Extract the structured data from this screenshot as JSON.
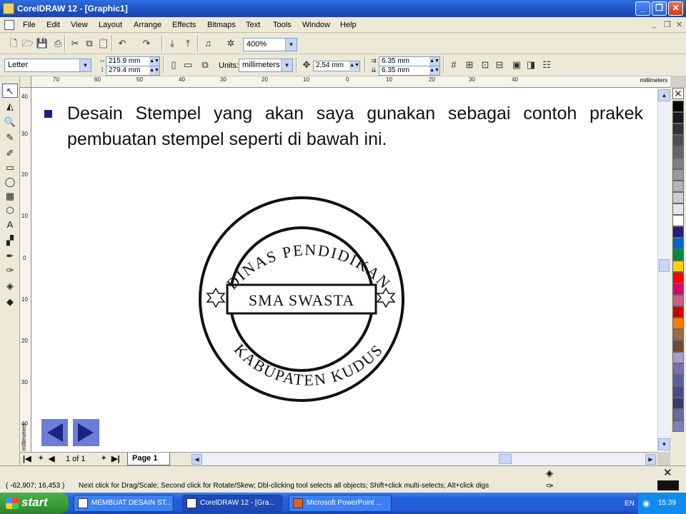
{
  "window": {
    "title": "CorelDRAW 12 - [Graphic1]"
  },
  "menu": [
    "File",
    "Edit",
    "View",
    "Layout",
    "Arrange",
    "Effects",
    "Bitmaps",
    "Text",
    "Tools",
    "Window",
    "Help"
  ],
  "toolbar": {
    "zoom": "400%"
  },
  "property_bar": {
    "paper": "Letter",
    "width": "215.9 mm",
    "height": "279.4 mm",
    "units_label": "Units:",
    "units": "millimeters",
    "nudge": "2,54 mm",
    "dup_x": "6.35 mm",
    "dup_y": "6.35 mm"
  },
  "ruler": {
    "unit": "millimeters",
    "h_labels": [
      "70",
      "60",
      "50",
      "40",
      "30",
      "20",
      "10",
      "0",
      "10",
      "20",
      "30",
      "40"
    ],
    "v_labels": [
      "40",
      "30",
      "20",
      "10",
      "0",
      "10",
      "20",
      "30",
      "40"
    ]
  },
  "slide": {
    "text": "Desain Stempel yang akan saya gunakan sebagai contoh prakek pembuatan stempel seperti di bawah ini.",
    "stamp_top": "DINAS PENDIDIKAN",
    "stamp_middle": "SMA SWASTA",
    "stamp_bottom": "KABUPATEN KUDUS",
    "accent_color": "#1a237e",
    "nav_color": "#6b7dd6"
  },
  "pagebar": {
    "count": "1 of 1",
    "tab": "Page 1"
  },
  "status": {
    "coords": "( -62,907; 16,453 )",
    "message": "Next click for Drag/Scale; Second click for Rotate/Skew; Dbl-clicking tool selects all objects; Shift+click multi-selects; Alt+click digs"
  },
  "palette": [
    "#000000",
    "#1a1a1a",
    "#333333",
    "#4d4d4d",
    "#666666",
    "#808080",
    "#999999",
    "#b3b3b3",
    "#cccccc",
    "#e6e6e6",
    "#ffffff",
    "#2b1a7a",
    "#0066cc",
    "#008a3e",
    "#ffd200",
    "#ff0000",
    "#e0006a",
    "#d05a80",
    "#cc0000",
    "#ff7a00",
    "#9b6a4a",
    "#6b4a3a",
    "#a89bd0",
    "#7a6fb5",
    "#5a5fa5",
    "#4a4a8a",
    "#3a3a6a",
    "#6a6aa5",
    "#8080c0"
  ],
  "taskbar": {
    "start": "start",
    "tasks": [
      "MEMBUAT DESAIN ST...",
      "CorelDRAW 12 - [Gra...",
      "Microsoft PowerPoint ..."
    ],
    "lang": "EN",
    "clock": "15:39"
  }
}
